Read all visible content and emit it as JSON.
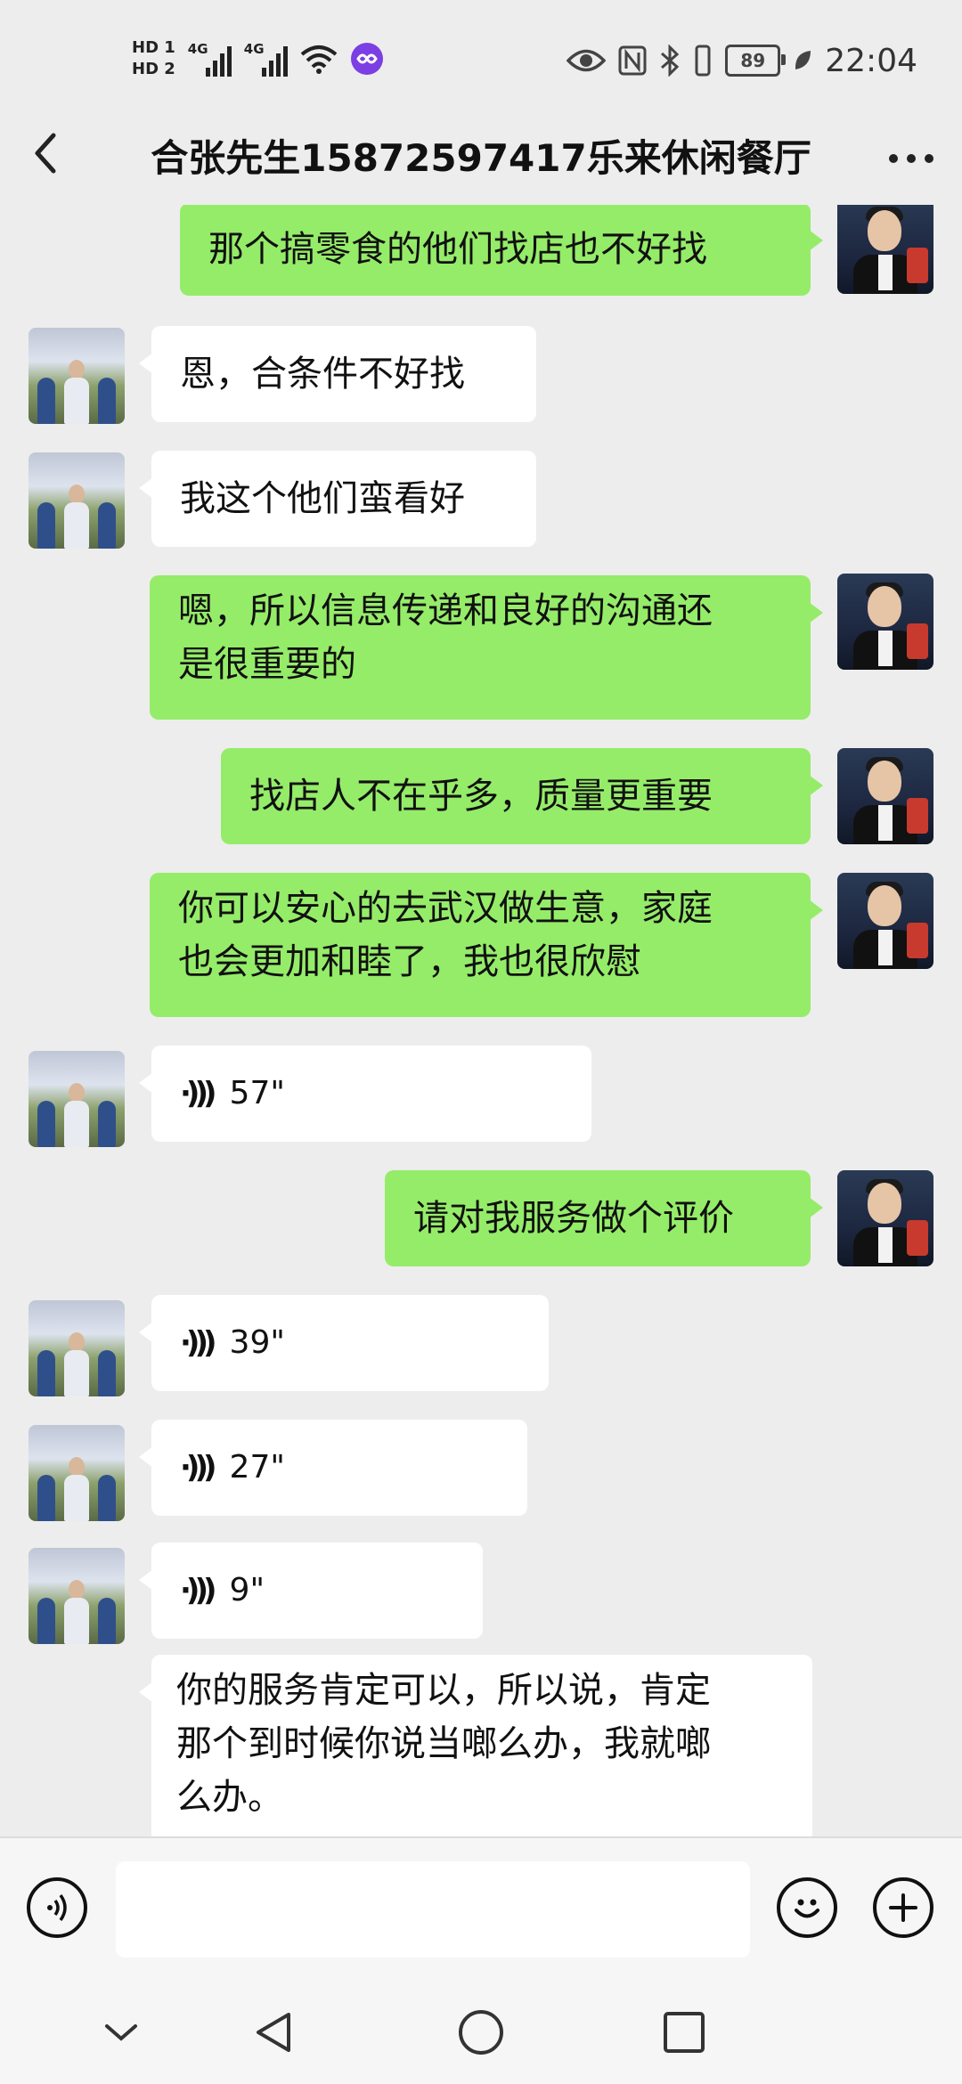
{
  "status_bar": {
    "hd1": "HD 1",
    "hd2": "HD 2",
    "net1": "4G",
    "net2": "4G",
    "battery": "89",
    "time": "22:04"
  },
  "header": {
    "back_icon": "chevron-left-icon",
    "title": "合张先生15872597417乐来休闲餐厅",
    "more_icon": "more-dots-icon"
  },
  "messages": [
    {
      "side": "me",
      "type": "text",
      "text": "那个搞零食的他们找店也不好找"
    },
    {
      "side": "other",
      "type": "text",
      "text": "恩，合条件不好找"
    },
    {
      "side": "other",
      "type": "text",
      "text": "我这个他们蛮看好"
    },
    {
      "side": "me",
      "type": "text",
      "lines": [
        "嗯，所以信息传递和良好的沟通还",
        "是很重要的"
      ]
    },
    {
      "side": "me",
      "type": "text",
      "text": "找店人不在乎多，质量更重要"
    },
    {
      "side": "me",
      "type": "text",
      "lines": [
        "你可以安心的去武汉做生意，家庭",
        "也会更加和睦了，我也很欣慰"
      ]
    },
    {
      "side": "other",
      "type": "voice",
      "duration": "57\""
    },
    {
      "side": "me",
      "type": "text",
      "text": "请对我服务做个评价"
    },
    {
      "side": "other",
      "type": "voice",
      "duration": "39\""
    },
    {
      "side": "other",
      "type": "voice",
      "duration": "27\""
    },
    {
      "side": "other",
      "type": "voice",
      "duration": "9\""
    },
    {
      "side": "other",
      "type": "text",
      "lines": [
        "你的服务肯定可以，所以说，肯定",
        "那个到时候你说当啷么办，我就啷",
        "么办。"
      ]
    }
  ],
  "input_bar": {
    "voice_toggle_icon": "voice-mode-icon",
    "placeholder": "",
    "emoji_icon": "emoji-icon",
    "plus_icon": "plus-icon"
  },
  "nav_bar": {
    "back": "nav-back-icon",
    "home": "nav-home-icon",
    "recents": "nav-recents-icon"
  },
  "colors": {
    "background": "#ededed",
    "my_bubble": "#95ec69",
    "other_bubble": "#ffffff"
  }
}
